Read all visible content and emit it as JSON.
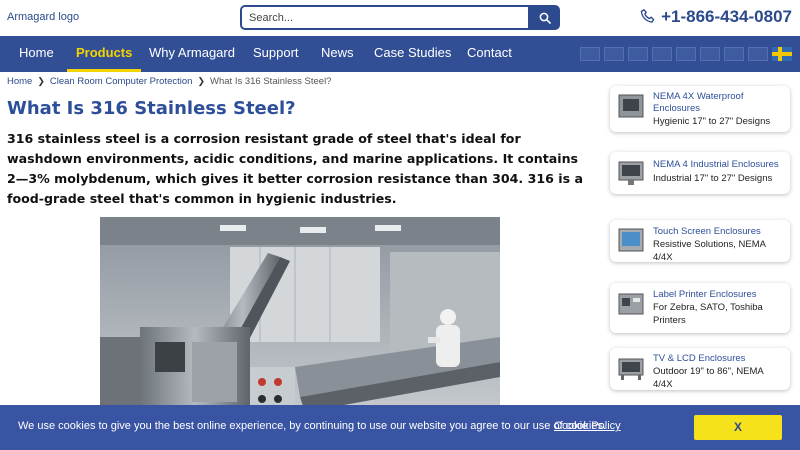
{
  "header": {
    "logo_alt": "Armagard logo",
    "search_placeholder": "Search...",
    "phone": "+1-866-434-0807"
  },
  "nav": {
    "items": [
      {
        "label": "Home",
        "active": false
      },
      {
        "label": "Products",
        "active": true
      },
      {
        "label": "Why Armagard",
        "active": false
      },
      {
        "label": "Support",
        "active": false
      },
      {
        "label": "News",
        "active": false
      },
      {
        "label": "Case Studies",
        "active": false
      },
      {
        "label": "Contact",
        "active": false
      }
    ]
  },
  "breadcrumb": {
    "items": [
      "Home",
      "Clean Room Computer Protection"
    ],
    "current": "What Is 316 Stainless Steel?"
  },
  "main": {
    "title": "What Is 316 Stainless Steel?",
    "intro": "316 stainless steel is a corrosion resistant grade of steel that's ideal for washdown environments, acidic conditions, and marine applications. It contains 2—3% molybdenum, which gives it better corrosion resistance than 304. 316 is a food-grade steel that's common in hygienic industries."
  },
  "sidebar": {
    "cards": [
      {
        "title": "NEMA 4X Waterproof Enclosures",
        "subtitle": "Hygienic 17\" to 27\" Designs"
      },
      {
        "title": "NEMA 4 Industrial Enclosures",
        "subtitle": "Industrial 17\" to 27\" Designs"
      },
      {
        "title": "Touch Screen Enclosures",
        "subtitle": "Resistive Solutions, NEMA 4/4X"
      },
      {
        "title": "Label Printer Enclosures",
        "subtitle": "For Zebra, SATO, Toshiba Printers"
      },
      {
        "title": "TV & LCD Enclosures",
        "subtitle": "Outdoor 19\" to 86\", NEMA 4/4X"
      }
    ]
  },
  "cookie": {
    "message": "We use cookies to give you the best online experience, by continuing to use our website you agree to our use of cookies.",
    "link": "Cookie Policy",
    "button": "X"
  },
  "colors": {
    "brand_blue": "#324f96",
    "accent_yellow": "#f5d300",
    "title_blue": "#2d4f9a"
  }
}
